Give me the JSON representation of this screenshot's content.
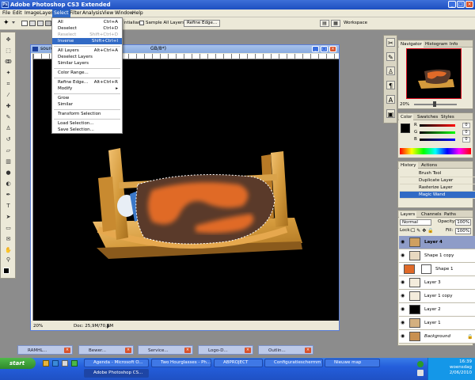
{
  "titlebar": {
    "title": "Adobe Photoshop CS3 Extended",
    "app_badge": "Ps"
  },
  "menubar": {
    "items": [
      "File",
      "Edit",
      "Image",
      "Layer",
      "Select",
      "Filter",
      "Analysis",
      "View",
      "Window",
      "Help"
    ],
    "active": "Select"
  },
  "options": {
    "antialias_tail": "ntialias",
    "sample_all_layers": "Sample All Layers",
    "refine_edge": "Refine Edge...",
    "workspace": "Workspace"
  },
  "select_menu": {
    "all": {
      "label": "All",
      "shortcut": "Ctrl+A"
    },
    "deselect": {
      "label": "Deselect",
      "shortcut": "Ctrl+D"
    },
    "reselect": {
      "label": "Reselect",
      "shortcut": "Shift+Ctrl+D"
    },
    "inverse": {
      "label": "Inverse",
      "shortcut": "Shift+Ctrl+I"
    },
    "all_layers": {
      "label": "All Layers",
      "shortcut": "Alt+Ctrl+A"
    },
    "deselect_layers": {
      "label": "Deselect Layers"
    },
    "similar_layers": {
      "label": "Similar Layers"
    },
    "color_range": {
      "label": "Color Range..."
    },
    "refine_edge": {
      "label": "Refine Edge...",
      "shortcut": "Alt+Ctrl+R"
    },
    "modify": {
      "label": "Modify",
      "arrow": "▸"
    },
    "grow": {
      "label": "Grow"
    },
    "similar": {
      "label": "Similar"
    },
    "transform_selection": {
      "label": "Transform Selection"
    },
    "load_selection": {
      "label": "Load Selection..."
    },
    "save_selection": {
      "label": "Save Selection..."
    }
  },
  "document": {
    "title_prefix": "sourc",
    "title_suffix": "GB/8*)",
    "zoom": "20%",
    "doc_info": "Doc: 25,9M/70,7M"
  },
  "navigator": {
    "tabs": [
      "Navigator",
      "Histogram",
      "Info"
    ],
    "zoom": "20%"
  },
  "color_panel": {
    "tabs": [
      "Color",
      "Swatches",
      "Styles"
    ],
    "r": "0",
    "g": "0",
    "b": "0"
  },
  "history": {
    "tabs": [
      "History",
      "Actions"
    ],
    "rows": [
      "Brush Tool",
      "Duplicate Layer",
      "Rasterize Layer",
      "Magic Wand"
    ],
    "active_index": 3
  },
  "layers_panel": {
    "tabs": [
      "Layers",
      "Channels",
      "Paths"
    ],
    "blend_mode": "Normal",
    "opacity_label": "Opacity:",
    "opacity": "100%",
    "lock_label": "Lock:",
    "fill_label": "Fill:",
    "fill": "100%",
    "rows": [
      {
        "name": "Layer 4",
        "selected": true
      },
      {
        "name": "Shape 1 copy"
      },
      {
        "name": "Shape 1"
      },
      {
        "name": "Layer 3"
      },
      {
        "name": "Layer 1 copy"
      },
      {
        "name": "Layer 2"
      },
      {
        "name": "Layer 1"
      },
      {
        "name": "Background"
      }
    ]
  },
  "mini_docs": [
    "RAMHL...",
    "Bewer...",
    "Service...",
    "Logo-D...",
    "Outlin..."
  ],
  "taskbar": {
    "start": "start",
    "buttons": [
      "Agenda - Microsoft O...",
      "Two Hourglasses - Ph...",
      "ABPROJECT",
      "Configuratieschermm",
      "Nieuwe map",
      "Adobe Photoshop CS..."
    ],
    "time": "16:39",
    "day": "woensdag",
    "date": "2/06/2010"
  },
  "colors": {
    "accent": "#316ac5",
    "xp_blue": "#245edb",
    "bed_wood": "#d49a3c",
    "fabric_orange": "#e06a28",
    "fabric_brown": "#5a3a2a"
  }
}
